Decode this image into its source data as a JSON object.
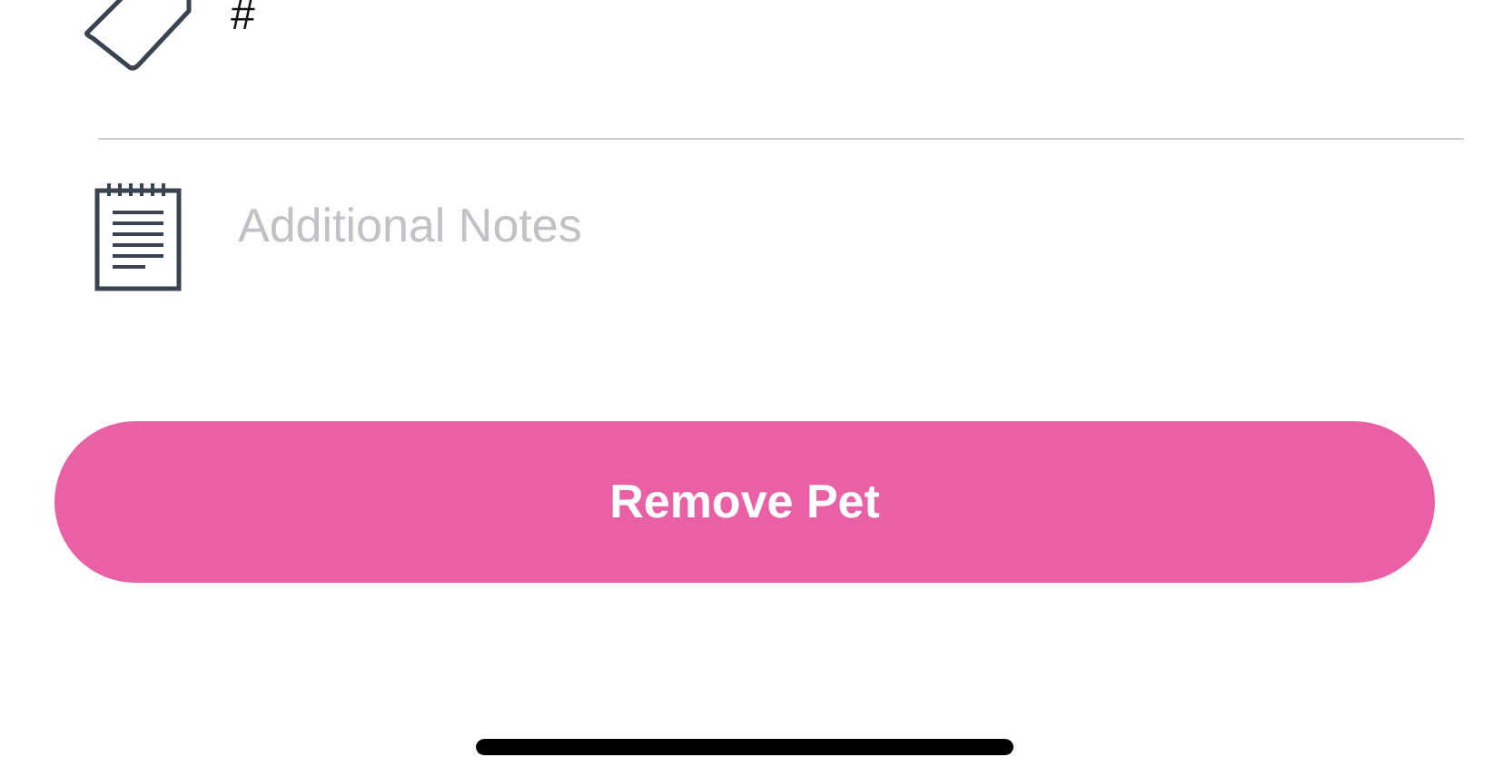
{
  "tag_field": {
    "value": "#"
  },
  "notes_field": {
    "placeholder": "Additional Notes"
  },
  "remove_button": {
    "label": "Remove Pet"
  }
}
